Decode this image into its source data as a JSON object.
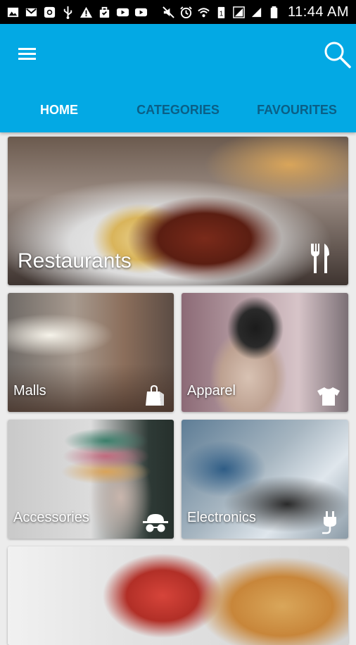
{
  "status_bar": {
    "time": "11:44 AM",
    "battery_level": "1",
    "left_icons": [
      "image-icon",
      "gmail-icon",
      "instagram-icon",
      "usb-icon",
      "warning-icon",
      "bag-icon",
      "youtube-icon",
      "youtube-icon"
    ],
    "right_icons": [
      "mute-icon",
      "alarm-icon",
      "wifi-icon",
      "battery-saver-icon",
      "signal-icon",
      "signal-icon",
      "battery-icon"
    ]
  },
  "app_bar": {
    "color": "#03a9e4",
    "menu_icon": "hamburger-menu-icon",
    "search_icon": "search-icon"
  },
  "tabs": [
    {
      "label": "HOME",
      "active": true
    },
    {
      "label": "CATEGORIES",
      "active": false
    },
    {
      "label": "FAVOURITES",
      "active": false
    }
  ],
  "categories": [
    {
      "label": "Restaurants",
      "icon": "fork-knife-icon"
    },
    {
      "label": "Malls",
      "icon": "shopping-bag-icon"
    },
    {
      "label": "Apparel",
      "icon": "tshirt-icon"
    },
    {
      "label": "Accessories",
      "icon": "hat-glasses-icon"
    },
    {
      "label": "Electronics",
      "icon": "plug-icon"
    },
    {
      "label": "",
      "icon": ""
    }
  ]
}
